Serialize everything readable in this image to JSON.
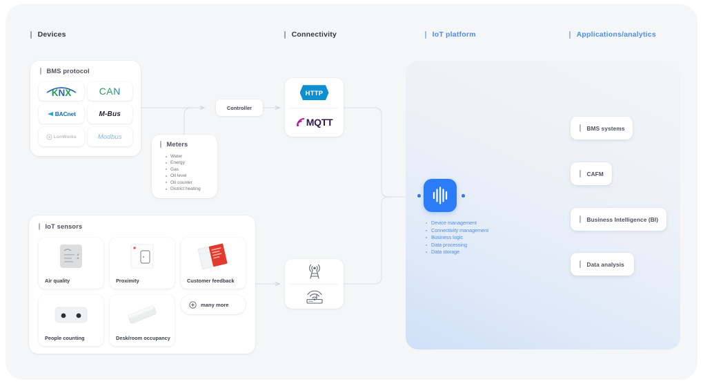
{
  "columns": [
    {
      "label": "Devices",
      "style": "dark"
    },
    {
      "label": "Connectivity",
      "style": "dark"
    },
    {
      "label": "IoT platform",
      "style": "blue"
    },
    {
      "label": "Applications/analytics",
      "style": "blue"
    }
  ],
  "devices": {
    "bms_protocol": {
      "title": "BMS protocol",
      "protocols": [
        {
          "name": "KNX",
          "color": "#1f9d55"
        },
        {
          "name": "CAN",
          "color": "#1f9d55"
        },
        {
          "name": "BACnet",
          "color": "#1669b5"
        },
        {
          "name": "M-Bus",
          "color": "#24262b"
        },
        {
          "name": "LonWorks",
          "color": "#b9bcc1"
        },
        {
          "name": "Modbus",
          "color": "#8ab6e4"
        }
      ]
    },
    "meters": {
      "title": "Meters",
      "items": [
        "Water",
        "Energy",
        "Gas",
        "Oil level",
        "Oil counter",
        "District heating"
      ]
    },
    "iot_sensors": {
      "title": "IoT sensors",
      "items": [
        {
          "label": "Air quality",
          "icon": "air-quality-sensor-icon"
        },
        {
          "label": "Proximity",
          "icon": "proximity-sensor-icon"
        },
        {
          "label": "Customer feedback",
          "icon": "customer-feedback-icon"
        },
        {
          "label": "People counting",
          "icon": "people-counting-sensor-icon"
        },
        {
          "label": "Desk/room occupancy",
          "icon": "desk-occupancy-sensor-icon"
        }
      ],
      "many_more_label": "many more"
    }
  },
  "connectivity": {
    "controller_label": "Controller",
    "protocols": [
      {
        "name": "HTTP",
        "color": "#0e8fd0"
      },
      {
        "name": "MQTT",
        "color": "#2b1a4a"
      }
    ],
    "radio": [
      {
        "icon": "cell-tower-icon"
      },
      {
        "icon": "wifi-router-icon"
      }
    ]
  },
  "platform": {
    "icon": "iot-platform-waveform-icon",
    "accent_color": "#2b7cf6",
    "capabilities": [
      "Device management",
      "Connectivity management",
      "Business logic",
      "Data processing",
      "Data storage"
    ]
  },
  "applications": [
    {
      "label": "BMS systems"
    },
    {
      "label": "CAFM"
    },
    {
      "label": "Business Intelligence (BI)"
    },
    {
      "label": "Data analysis"
    }
  ]
}
